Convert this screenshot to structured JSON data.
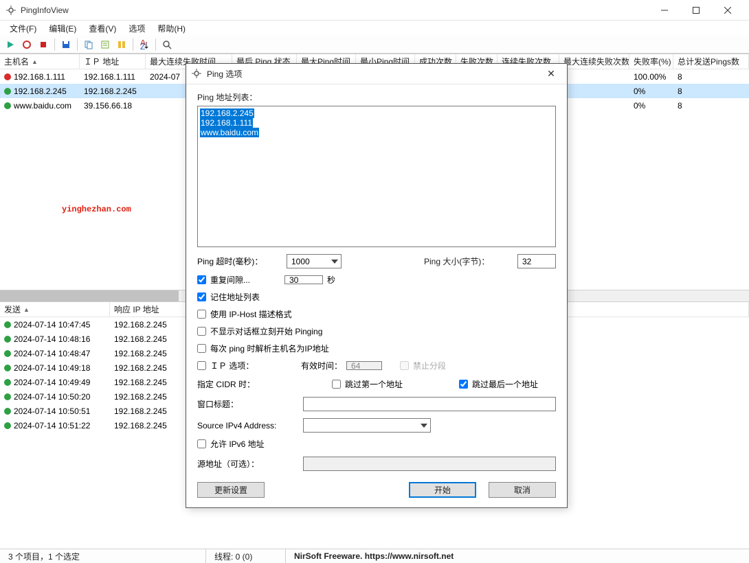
{
  "window": {
    "title": "PingInfoView"
  },
  "menu": {
    "file": "文件(F)",
    "edit": "编辑(E)",
    "view": "查看(V)",
    "options": "选项",
    "help": "帮助(H)"
  },
  "toolbar_icons": {
    "play": "play-icon",
    "stop": "stop-icon",
    "record": "record-icon",
    "save": "save-icon",
    "copy": "copy-icon",
    "export": "export-icon",
    "cols": "cols-icon",
    "sort": "sort-icon",
    "find": "find-icon"
  },
  "main_columns": {
    "c0": "主机名",
    "c1": "ＩＰ 地址",
    "c2": "最大连续失败时间",
    "c3": "最后 Ping 状态",
    "c4": "最大Ping时间",
    "c5": "最小Ping时间",
    "c6": "成功次数",
    "c7": "失败次数",
    "c8": "连续失败次数",
    "c9": "最大连续失败次数",
    "c10": "失败率(%)",
    "c11": "总计发送Pings数"
  },
  "main_rows": [
    {
      "status": "red",
      "host": "192.168.1.111",
      "ip": "192.168.1.111",
      "maxfail": "2024-07",
      "failrate": "100.00%",
      "pings": "8"
    },
    {
      "status": "green",
      "host": "192.168.2.245",
      "ip": "192.168.2.245",
      "maxfail": "",
      "failrate": "0%",
      "pings": "8"
    },
    {
      "status": "green",
      "host": "www.baidu.com",
      "ip": "39.156.66.18",
      "maxfail": "",
      "failrate": "0%",
      "pings": "8"
    }
  ],
  "watermark": "yinghezhan.com",
  "lower_columns": {
    "c0": "发送",
    "c1": "响应 IP 地址"
  },
  "lower_rows": [
    {
      "t": "2024-07-14 10:47:45",
      "ip": "192.168.2.245"
    },
    {
      "t": "2024-07-14 10:48:16",
      "ip": "192.168.2.245"
    },
    {
      "t": "2024-07-14 10:48:47",
      "ip": "192.168.2.245"
    },
    {
      "t": "2024-07-14 10:49:18",
      "ip": "192.168.2.245"
    },
    {
      "t": "2024-07-14 10:49:49",
      "ip": "192.168.2.245"
    },
    {
      "t": "2024-07-14 10:50:20",
      "ip": "192.168.2.245"
    },
    {
      "t": "2024-07-14 10:50:51",
      "ip": "192.168.2.245"
    },
    {
      "t": "2024-07-14 10:51:22",
      "ip": "192.168.2.245"
    }
  ],
  "statusbar": {
    "items": "3 个项目，1 个选定",
    "threads": "线程: 0 (0)",
    "credit": "NirSoft Freeware. https://www.nirsoft.net"
  },
  "dialog": {
    "title": "Ping 选项",
    "addr_label": "Ping 地址列表：",
    "addresses": [
      "192.168.2.245",
      "192.168.1.111",
      "www.baidu.com"
    ],
    "timeout_label": "Ping 超时(毫秒)：",
    "timeout_value": "1000",
    "size_label": "Ping 大小(字节)：",
    "size_value": "32",
    "repeat_label": "重复间隙...",
    "repeat_value": "30",
    "repeat_unit": "秒",
    "remember_label": "记住地址列表",
    "iphost_label": "使用 IP-Host 描述格式",
    "nodlg_label": "不显示对话框立刻开始 Pinging",
    "resolve_label": "每次 ping 时解析主机名为IP地址",
    "ipopt_label": "ＩＰ 选项：",
    "ttl_label": "有效时间：",
    "ttl_value": "64",
    "nofrag_label": "禁止分段",
    "cidr_label": "指定 CIDR 时：",
    "skip_first_label": "跳过第一个地址",
    "skip_last_label": "跳过最后一个地址",
    "wintitle_label": "窗口标题：",
    "wintitle_value": "",
    "srcip_label": "Source IPv4 Address:",
    "srcip_value": "",
    "ipv6_label": "允许 IPv6 地址",
    "srcopt_label": "源地址（可选）：",
    "srcopt_value": "",
    "btn_update": "更新设置",
    "btn_start": "开始",
    "btn_cancel": "取消"
  }
}
